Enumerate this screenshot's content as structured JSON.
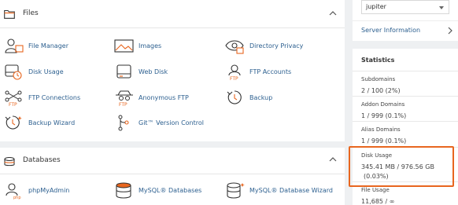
{
  "files_section": {
    "title": "Files",
    "apps": [
      {
        "label": "File Manager",
        "icon": "file-manager-icon"
      },
      {
        "label": "Images",
        "icon": "images-icon"
      },
      {
        "label": "Directory Privacy",
        "icon": "directory-privacy-icon"
      },
      {
        "label": "Disk Usage",
        "icon": "disk-usage-icon"
      },
      {
        "label": "Web Disk",
        "icon": "web-disk-icon"
      },
      {
        "label": "FTP Accounts",
        "icon": "ftp-accounts-icon"
      },
      {
        "label": "FTP Connections",
        "icon": "ftp-connections-icon"
      },
      {
        "label": "Anonymous FTP",
        "icon": "anonymous-ftp-icon"
      },
      {
        "label": "Backup",
        "icon": "backup-icon"
      },
      {
        "label": "Backup Wizard",
        "icon": "backup-wizard-icon"
      },
      {
        "label": "Git™ Version Control",
        "icon": "git-icon"
      }
    ]
  },
  "databases_section": {
    "title": "Databases",
    "apps": [
      {
        "label": "phpMyAdmin",
        "icon": "phpmyadmin-icon"
      },
      {
        "label": "MySQL® Databases",
        "icon": "mysql-databases-icon"
      },
      {
        "label": "MySQL® Database Wizard",
        "icon": "mysql-wizard-icon"
      }
    ]
  },
  "sidebar": {
    "theme_select": "jupiter",
    "server_info": "Server Information",
    "statistics_title": "Statistics",
    "stats": [
      {
        "key": "Subdomains",
        "value": "2 / 100   (2%)"
      },
      {
        "key": "Addon Domains",
        "value": "1 / 999   (0.1%)"
      },
      {
        "key": "Alias Domains",
        "value": "1 / 999   (0.1%)"
      },
      {
        "key": "Disk Usage",
        "value": "345.41 MB / 976.56 GB",
        "value2": "(0.03%)"
      },
      {
        "key": "File Usage",
        "value": "11,685 / ∞"
      }
    ]
  },
  "colors": {
    "accent_orange": "#e8661f",
    "link_blue": "#2c5f8f"
  }
}
